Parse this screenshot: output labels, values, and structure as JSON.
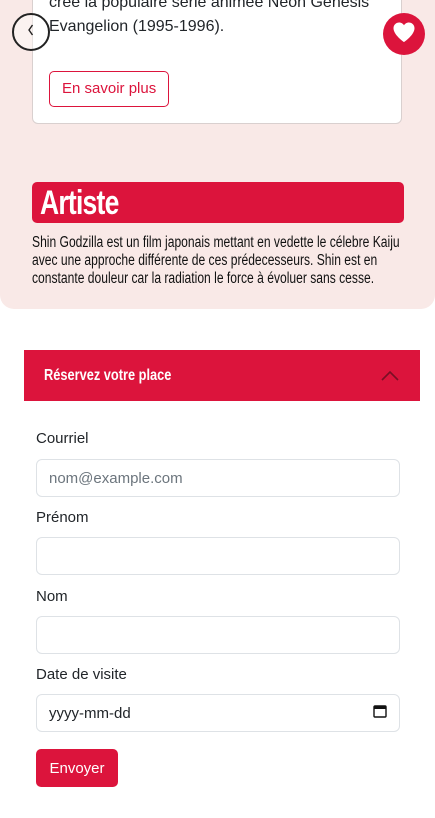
{
  "intro_card": {
    "text": "créé la populaire série animée Neon Genesis Evangelion (1995-1996).",
    "more_label": "En savoir plus"
  },
  "artist": {
    "title": "Artiste",
    "text": "Shin Godzilla est un film japonais mettant en vedette le célebre Kaiju avec une approche différente de ces prédecesseurs. Shin est en constante douleur car la radiation le force à évoluer sans cesse."
  },
  "nav": {
    "back_glyph": "‹",
    "heart_icon": "heart-icon"
  },
  "reservation": {
    "header": "Réservez votre place",
    "fields": {
      "email_label": "Courriel",
      "email_placeholder": "nom@example.com",
      "firstname_label": "Prénom",
      "lastname_label": "Nom",
      "date_label": "Date de visite",
      "date_placeholder": "yyyy-mm-dd"
    },
    "submit_label": "Envoyer"
  },
  "colors": {
    "accent": "#dc143c",
    "pink_bg": "#f9e9e7"
  }
}
